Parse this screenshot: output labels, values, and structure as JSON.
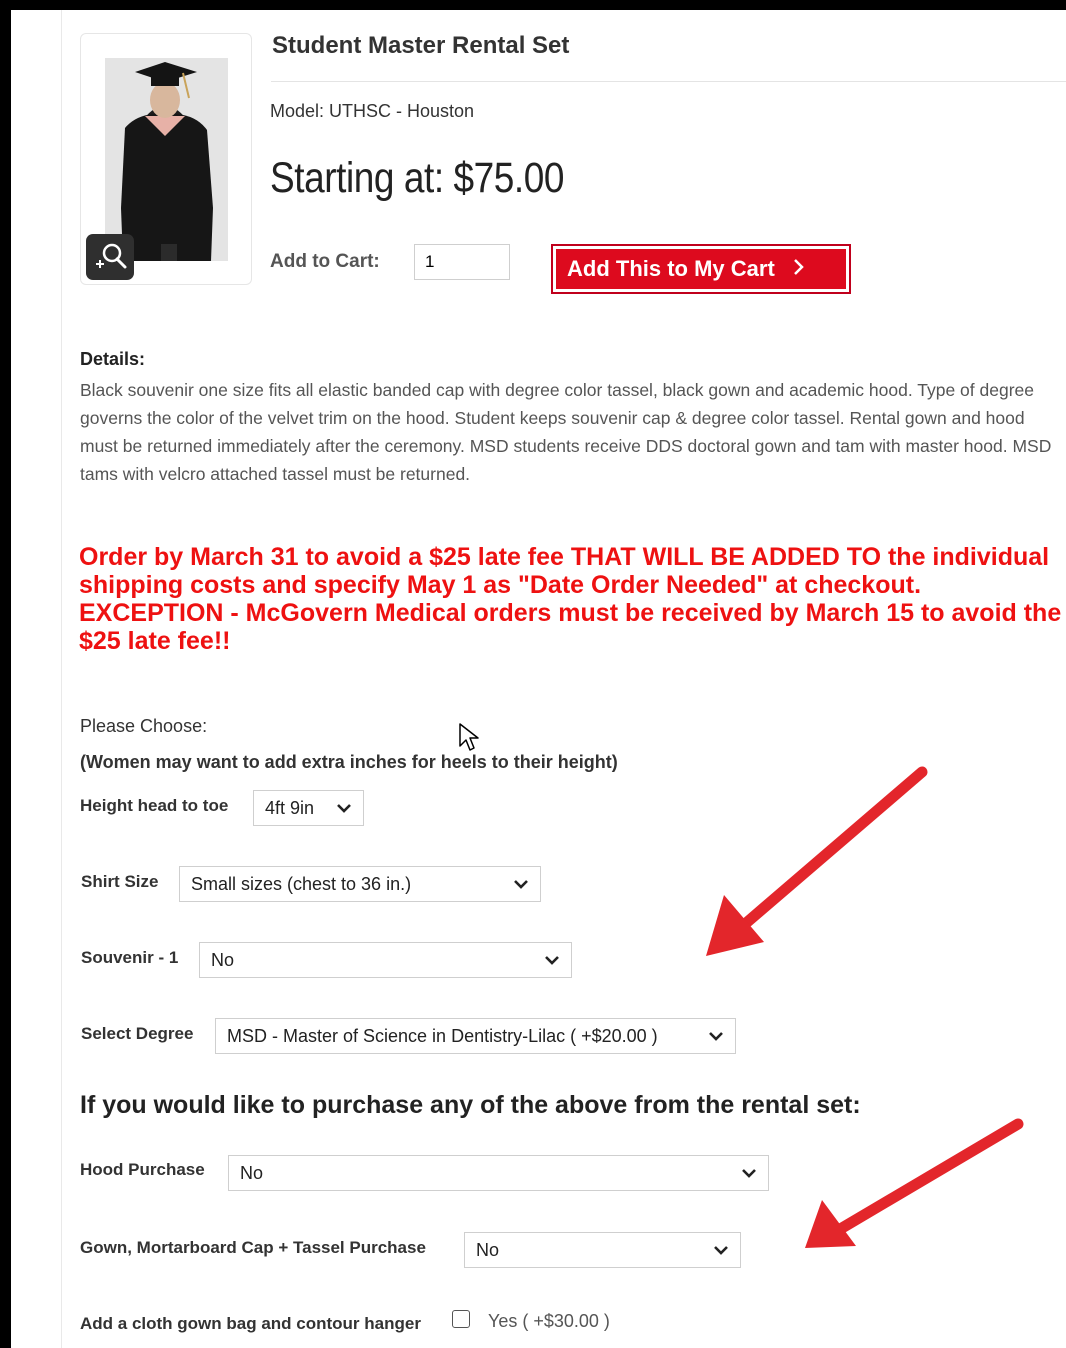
{
  "product": {
    "title": "Student Master Rental Set",
    "model": "Model: UTHSC - Houston",
    "price": "Starting at: $75.00",
    "add_to_cart_label": "Add to Cart:",
    "quantity": "1",
    "cart_button_label": "Add This to My Cart",
    "cart_button_icon": "chevron-right-icon",
    "zoom_icon": "zoom-in-icon"
  },
  "details": {
    "heading": "Details:",
    "text": "Black souvenir one size fits all elastic banded cap with degree color tassel, black gown and academic hood. Type of degree governs the color of the velvet trim on the hood. Student keeps souvenir cap & degree color tassel. Rental gown and hood must be returned immediately after the ceremony. MSD students receive DDS doctoral gown and tam with master hood. MSD tams with velcro attached tassel must be returned."
  },
  "notice": "Order by March 31 to avoid a $25 late fee THAT WILL BE ADDED TO the individual shipping costs and specify May 1 as \"Date Order Needed\" at checkout. EXCEPTION - McGovern Medical orders must be received by March 15 to avoid the $25 late fee!!",
  "options": {
    "choose_label": "Please Choose:",
    "women_note": "(Women may want to add extra inches for heels to their height)",
    "height_label": "Height head to toe",
    "height_value": "4ft 9in",
    "shirt_label": "Shirt Size",
    "shirt_value": "Small sizes (chest to 36 in.)",
    "souvenir_label": "Souvenir - 1",
    "souvenir_value": "No",
    "degree_label": "Select Degree",
    "degree_value": "MSD - Master of Science in Dentistry-Lilac ( +$20.00 )"
  },
  "purchase": {
    "heading": "If you would like to purchase any of the above from the rental set:",
    "hood_label": "Hood Purchase",
    "hood_value": "No",
    "gown_label": "Gown, Mortarboard Cap + Tassel Purchase",
    "gown_value": "No",
    "bag_label": "Add a cloth gown bag and contour hanger",
    "bag_checked": false,
    "bag_option": "Yes ( +$30.00 )"
  },
  "colors": {
    "accent_red": "#dd0a1e",
    "notice_red": "#ee1111",
    "annotation_arrow": "#e3262b"
  }
}
